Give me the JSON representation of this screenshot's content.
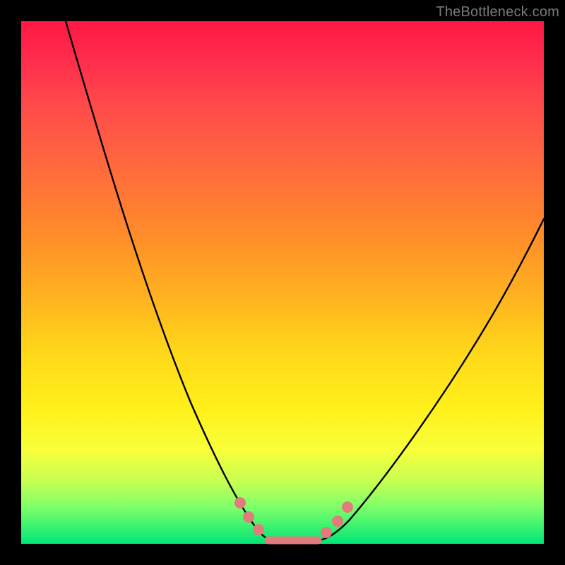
{
  "watermark": "TheBottleneck.com",
  "colors": {
    "frame": "#000000",
    "gradient_top": "#ff1744",
    "gradient_mid1": "#ff8a2b",
    "gradient_mid2": "#ffd91a",
    "gradient_bottom": "#00e676",
    "curve": "#000000",
    "marker": "#e27b7b",
    "watermark_text": "#7a7a7a"
  },
  "chart_data": {
    "type": "line",
    "title": "",
    "xlabel": "",
    "ylabel": "",
    "xlim": [
      0,
      100
    ],
    "ylim": [
      0,
      100
    ],
    "grid": false,
    "legend": false,
    "annotations": [
      "TheBottleneck.com"
    ],
    "series": [
      {
        "name": "bottleneck-curve",
        "x": [
          0,
          5,
          10,
          15,
          20,
          25,
          30,
          35,
          40,
          45,
          47.5,
          50,
          52.5,
          55,
          57.5,
          60,
          65,
          70,
          75,
          80,
          85,
          90,
          95,
          100
        ],
        "y": [
          100,
          89,
          78,
          67,
          56,
          45,
          34,
          24,
          16,
          8,
          4,
          2,
          1,
          0.5,
          0.5,
          1,
          3,
          7,
          13,
          21,
          30,
          40,
          51,
          62
        ]
      }
    ],
    "marker_points": {
      "name": "highlight-dots",
      "x": [
        40.5,
        42.5,
        44,
        57,
        59,
        61
      ],
      "y": [
        10,
        7,
        5,
        3,
        5,
        8
      ]
    },
    "flat_bottom": {
      "x_start": 45,
      "x_end": 56,
      "y": 0.3
    }
  }
}
